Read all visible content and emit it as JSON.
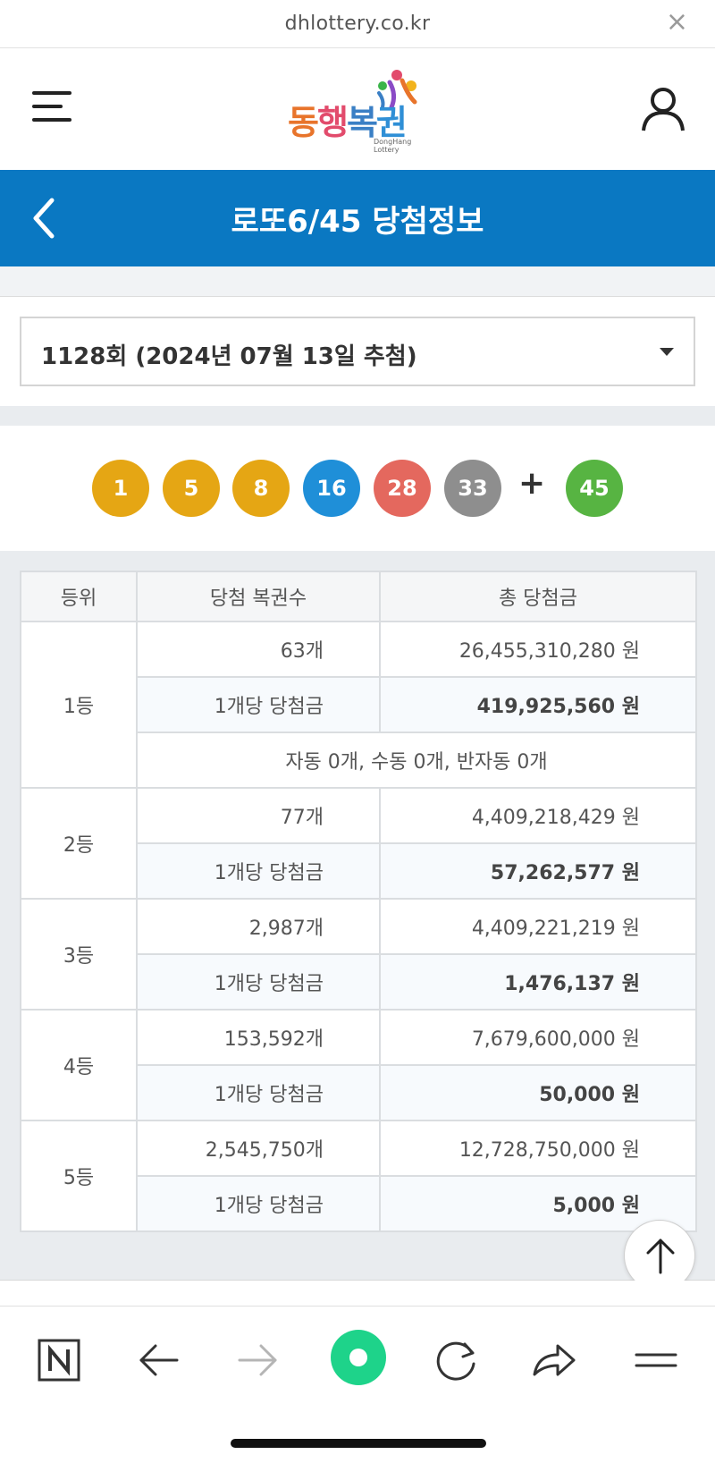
{
  "browser": {
    "url": "dhlottery.co.kr",
    "close_icon": "close-icon"
  },
  "header": {
    "logo_text": "동행복권",
    "logo_subtext": "DongHang Lottery",
    "menu_icon": "hamburger-icon",
    "user_icon": "user-icon"
  },
  "titlebar": {
    "title": "로또6/45 당첨정보",
    "back_icon": "chevron-left-icon"
  },
  "draw_select": {
    "value": "1128회 (2024년 07월 13일 추첨)"
  },
  "colors": {
    "brand_blue": "#0a78c2",
    "ball_yellow": "#e5a614",
    "ball_blue": "#1f8fd8",
    "ball_red": "#e4685e",
    "ball_gray": "#8e8e8e",
    "ball_green": "#57b442"
  },
  "numbers": {
    "main": [
      {
        "value": "1",
        "color": "#e5a614"
      },
      {
        "value": "5",
        "color": "#e5a614"
      },
      {
        "value": "8",
        "color": "#e5a614"
      },
      {
        "value": "16",
        "color": "#1f8fd8"
      },
      {
        "value": "28",
        "color": "#e4685e"
      },
      {
        "value": "33",
        "color": "#8e8e8e"
      }
    ],
    "plus": "+",
    "bonus": {
      "value": "45",
      "color": "#57b442"
    }
  },
  "table": {
    "headers": [
      "등위",
      "당첨 복권수",
      "총 당첨금"
    ],
    "rows": [
      {
        "rank": "1등",
        "count": "63개",
        "total": "26,455,310,280 원",
        "per_label": "1개당 당첨금",
        "per_amount": "419,925,560 원",
        "note": "자동 0개, 수동 0개, 반자동 0개"
      },
      {
        "rank": "2등",
        "count": "77개",
        "total": "4,409,218,429 원",
        "per_label": "1개당 당첨금",
        "per_amount": "57,262,577 원"
      },
      {
        "rank": "3등",
        "count": "2,987개",
        "total": "4,409,221,219 원",
        "per_label": "1개당 당첨금",
        "per_amount": "1,476,137 원"
      },
      {
        "rank": "4등",
        "count": "153,592개",
        "total": "7,679,600,000 원",
        "per_label": "1개당 당첨금",
        "per_amount": "50,000 원"
      },
      {
        "rank": "5등",
        "count": "2,545,750개",
        "total": "12,728,750,000 원",
        "per_label": "1개당 당첨금",
        "per_amount": "5,000 원"
      }
    ]
  },
  "bottom_bar": {
    "items": [
      "naver-n-icon",
      "back-arrow-icon",
      "forward-arrow-icon",
      "green-dot-icon",
      "refresh-icon",
      "share-icon",
      "menu-lines-icon"
    ]
  }
}
